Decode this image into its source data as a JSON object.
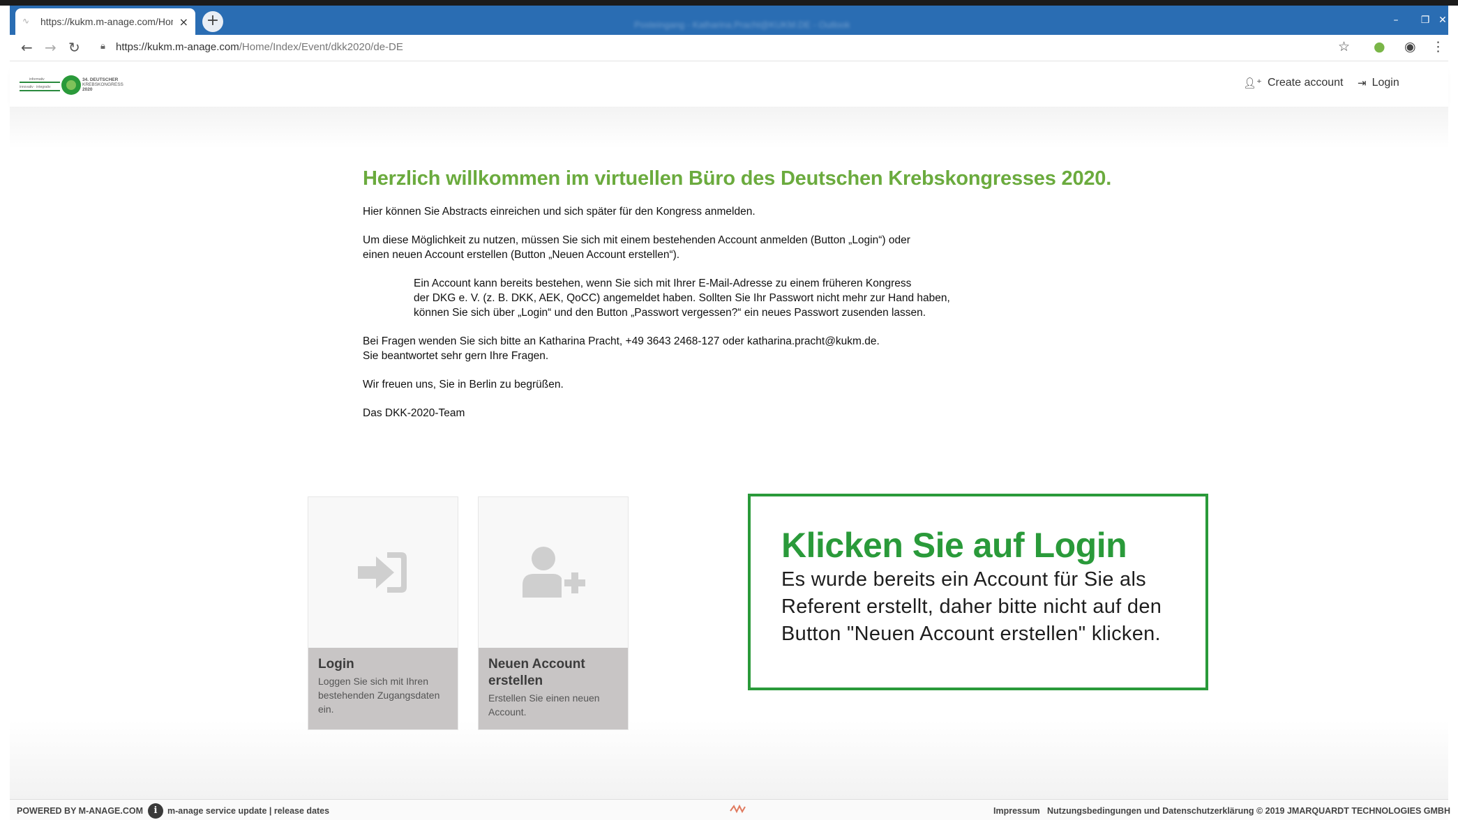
{
  "browser": {
    "tab_title": "https://kukm.m-anage.com/Hom",
    "titlebar_text": "Posteingang - Katharina.Pracht@KUKM.DE - Outlook",
    "url_domain": "https://kukm.m-anage.com",
    "url_path": "/Home/Index/Event/dkk2020/de-DE"
  },
  "header": {
    "create_account": "Create account",
    "login": "Login"
  },
  "logo": {
    "line1": "34. DEUTSCHER",
    "line2": "KREBSKONGRESS",
    "line3": "2020",
    "left_text": "informativ · innovativ · integrativ"
  },
  "main": {
    "heading": "Herzlich willkommen im virtuellen Büro des Deutschen Krebskongresses 2020.",
    "p1": "Hier können Sie Abstracts einreichen und sich später für den Kongress anmelden.",
    "p2a": "Um diese Möglichkeit zu nutzen, müssen Sie sich mit einem bestehenden Account anmelden (Button „Login“) oder",
    "p2b": "einen neuen Account erstellen (Button „Neuen Account erstellen“).",
    "p3a": "Ein Account kann bereits bestehen, wenn Sie sich mit Ihrer E-Mail-Adresse zu einem früheren Kongress",
    "p3b": "der DKG e. V. (z. B. DKK, AEK, QoCC) angemeldet haben. Sollten Sie Ihr Passwort nicht mehr zur Hand haben,",
    "p3c": "können Sie sich über „Login“ und den Button „Passwort vergessen?“ ein neues Passwort zusenden lassen.",
    "p4a": "Bei Fragen wenden Sie sich bitte an Katharina Pracht, +49 3643 2468-127 oder katharina.pracht@kukm.de.",
    "p4b": "Sie beantwortet sehr gern Ihre Fragen.",
    "p5": "Wir freuen uns, Sie in Berlin zu begrüßen.",
    "p6": "Das DKK-2020-Team"
  },
  "tiles": {
    "login_title": "Login",
    "login_desc": "Loggen Sie sich mit Ihren bestehenden Zugangsdaten ein.",
    "new_title": "Neuen Account erstellen",
    "new_desc": "Erstellen Sie einen neuen Account."
  },
  "callout": {
    "title": "Klicken Sie auf Login",
    "text": "Es wurde bereits ein Account für Sie als Referent erstellt, daher bitte nicht auf den Button \"Neuen Account erstellen\" klicken."
  },
  "footer": {
    "powered": "POWERED BY M-ANAGE.COM",
    "service": "m-anage service update | release dates",
    "impressum": "Impressum",
    "terms": "Nutzungsbedingungen und Datenschutzerklärung",
    "copyright": "© 2019 JMARQUARDT TECHNOLOGIES GMBH"
  },
  "colors": {
    "heading_green": "#6bab3e",
    "callout_green": "#2a9a3a",
    "titlebar_blue": "#2a6db3"
  }
}
